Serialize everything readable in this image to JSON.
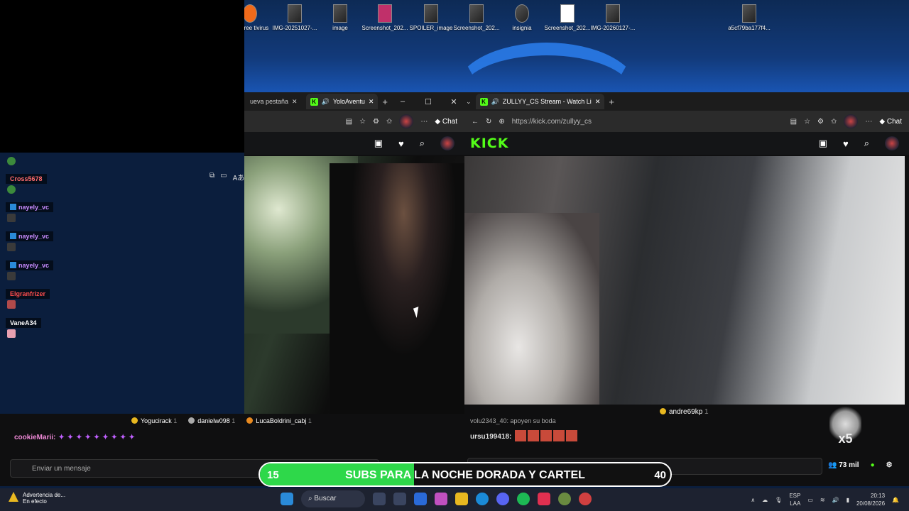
{
  "desktop_icons": [
    {
      "label": "ast Free\ntivirus"
    },
    {
      "label": "IMG-20251027-..."
    },
    {
      "label": "image"
    },
    {
      "label": "Screenshot_202..."
    },
    {
      "label": "SPOILER_image"
    },
    {
      "label": "Screenshot_202..."
    },
    {
      "label": "insignia"
    },
    {
      "label": "Screenshot_202..."
    },
    {
      "label": "IMG-20260127-..."
    },
    {
      "label": "a5cf79ba177f4..."
    }
  ],
  "left_browser": {
    "tab_prev": "ueva pestaña",
    "tab_active": "YoloAventu",
    "chat_label": "Chat"
  },
  "left_chat": [
    {
      "name": "Cross5678",
      "color": "#ff6b6b"
    },
    {
      "name": "nayely_vc",
      "color": "#c98cff"
    },
    {
      "name": "nayely_vc",
      "color": "#c98cff"
    },
    {
      "name": "nayely_vc",
      "color": "#c98cff"
    },
    {
      "name": "Elgranfrizer",
      "color": "#ff4d4d"
    },
    {
      "name": "VaneA34",
      "color": "#ffffff"
    }
  ],
  "gift_bar": [
    {
      "name": "Yogucirack",
      "count": "1"
    },
    {
      "name": "danielw098",
      "count": "1"
    },
    {
      "name": "LucaBoldrini_cabj",
      "count": "1"
    }
  ],
  "cookie_msg": {
    "name": "cookieMarii:"
  },
  "send_placeholder": "Enviar un mensaje",
  "right_browser": {
    "tab_title": "ZULLYY_CS Stream - Watch Li",
    "url": "https://kick.com/zullyy_cs",
    "chat_label": "Chat",
    "logo": "KICK"
  },
  "right_gift": {
    "name": "andre69kp",
    "count": "1"
  },
  "right_chat": {
    "line1": "volu2343_40: apoyen su boda",
    "line2_name": "ursu199418:"
  },
  "x5": "x5",
  "viewers": "73 mil",
  "banner": {
    "left": "15",
    "text": "SUBS PARA LA NOCHE DORADA Y CARTEL",
    "right": "40",
    "progress": 0.375
  },
  "taskbar": {
    "warn_title": "Advertencia de...",
    "warn_sub": "En efecto",
    "search": "Buscar",
    "lang1": "ESP",
    "lang2": "LAA",
    "time": "20:13",
    "date": "20/08/2026"
  }
}
